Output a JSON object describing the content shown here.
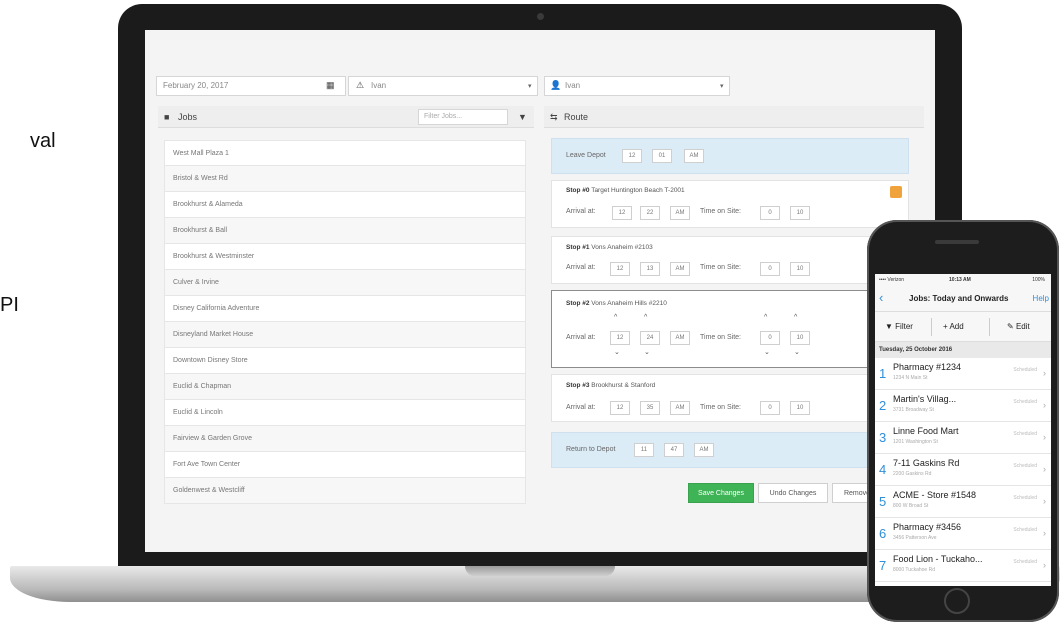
{
  "side_fragments": [
    "val",
    "PI"
  ],
  "toolbar": {
    "date_value": "February 20, 2017",
    "calendar_icon": "calendar-icon",
    "driver_select": "Ivan",
    "vehicle_select": "Ivan"
  },
  "jobs_panel": {
    "title": "Jobs",
    "filter_placeholder": "Filter Jobs...",
    "items": [
      "West Mall Plaza 1",
      "Bristol & West Rd",
      "Brookhurst & Alameda",
      "Brookhurst & Ball",
      "Brookhurst & Westminster",
      "Culver & Irvine",
      "Disney California Adventure",
      "Disneyland Market House",
      "Downtown Disney Store",
      "Euclid & Chapman",
      "Euclid & Lincoln",
      "Fairview & Garden Grove",
      "Fort Ave Town Center",
      "Goldenwest & Westcliff"
    ]
  },
  "route_panel": {
    "title": "Route",
    "leave_depot": {
      "label": "Leave Depot",
      "h": "12",
      "m": "01",
      "ampm": "AM"
    },
    "stops": [
      {
        "title_bold": "Stop #0",
        "title_rest": "Target Huntington Beach T-2001",
        "arrival_label": "Arrival at:",
        "h": "12",
        "m": "22",
        "ampm": "AM",
        "tos_label": "Time on Site:",
        "tos_h": "0",
        "tos_m": "10"
      },
      {
        "title_bold": "Stop #1",
        "title_rest": "Vons Anaheim #2103",
        "arrival_label": "Arrival at:",
        "h": "12",
        "m": "13",
        "ampm": "AM",
        "tos_label": "Time on Site:",
        "tos_h": "0",
        "tos_m": "10"
      },
      {
        "title_bold": "Stop #2",
        "title_rest": "Vons Anaheim Hills #2210",
        "arrival_label": "Arrival at:",
        "h": "12",
        "m": "24",
        "ampm": "AM",
        "tos_label": "Time on Site:",
        "tos_h": "0",
        "tos_m": "10"
      },
      {
        "title_bold": "Stop #3",
        "title_rest": "Brookhurst & Stanford",
        "arrival_label": "Arrival at:",
        "h": "12",
        "m": "35",
        "ampm": "AM",
        "tos_label": "Time on Site:",
        "tos_h": "0",
        "tos_m": "10"
      }
    ],
    "return_depot": {
      "label": "Return to Depot",
      "h": "11",
      "m": "47",
      "ampm": "AM"
    },
    "buttons": {
      "save": "Save Changes",
      "undo": "Undo Changes",
      "remove": "Remove"
    }
  },
  "phone": {
    "status_left": "•••• Verizon",
    "status_time": "10:13 AM",
    "status_right": "100%",
    "nav_title": "Jobs: Today and Onwards",
    "nav_help": "Help",
    "filter": "Filter",
    "add": "Add",
    "edit": "Edit",
    "date_header": "Tuesday, 25 October 2016",
    "items": [
      {
        "num": "1",
        "name": "Pharmacy #1234",
        "sub": "1234 N Main St",
        "right": "Scheduled"
      },
      {
        "num": "2",
        "name": "Martin's Villag...",
        "sub": "3731 Broadway St",
        "right": "Scheduled"
      },
      {
        "num": "3",
        "name": "Linne Food Mart",
        "sub": "1201 Washington St",
        "right": "Scheduled"
      },
      {
        "num": "4",
        "name": "7-11 Gaskins Rd",
        "sub": "2200 Gaskins Rd",
        "right": "Scheduled"
      },
      {
        "num": "5",
        "name": "ACME - Store #1548",
        "sub": "800 W Broad St",
        "right": "Scheduled"
      },
      {
        "num": "6",
        "name": "Pharmacy #3456",
        "sub": "3456 Patterson Ave",
        "right": "Scheduled"
      },
      {
        "num": "7",
        "name": "Food Lion - Tuckaho...",
        "sub": "8000 Tuckahoe Rd",
        "right": "Scheduled"
      }
    ]
  }
}
